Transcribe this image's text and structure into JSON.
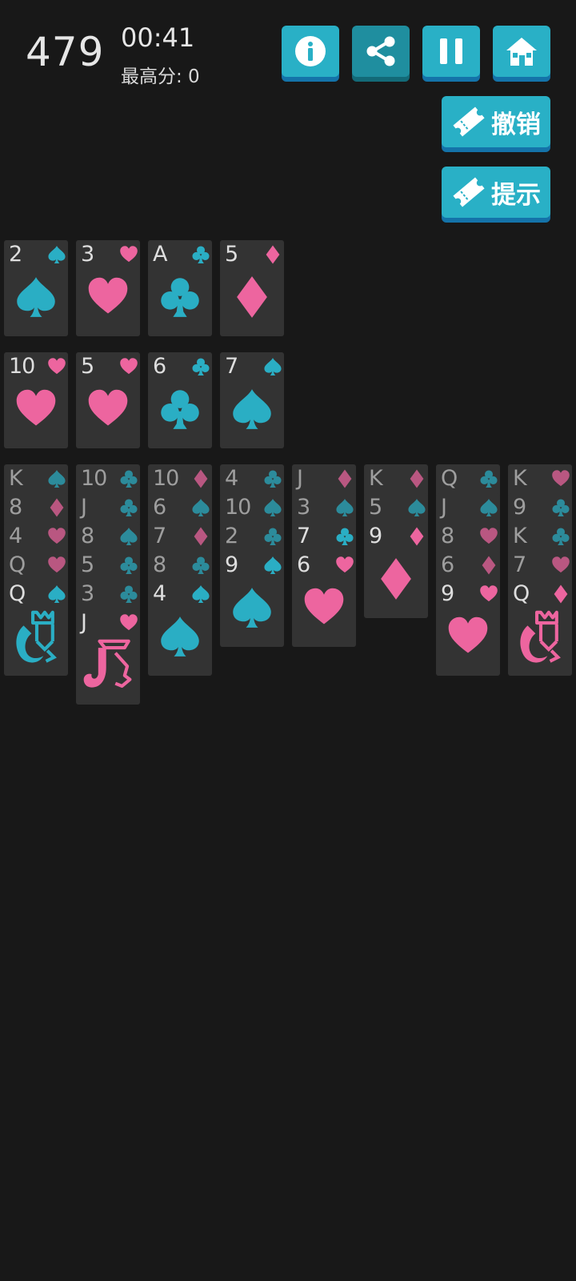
{
  "header": {
    "score": "479",
    "timer": "00:41",
    "best_score": "最高分:  0"
  },
  "toolbar": [
    {
      "name": "info-button",
      "icon": "info-icon"
    },
    {
      "name": "share-button",
      "icon": "share-icon"
    },
    {
      "name": "pause-button",
      "icon": "pause-icon"
    },
    {
      "name": "home-button",
      "icon": "home-icon"
    }
  ],
  "actions": {
    "undo_label": "撤销",
    "hint_label": "提示"
  },
  "colors": {
    "black_suit": "#2aaec4",
    "red_suit": "#ed659f",
    "button": "#29b0c6",
    "background": "#181818",
    "card": "#333333"
  },
  "free_cells": [
    {
      "rank": "2",
      "suit": "spade"
    },
    {
      "rank": "3",
      "suit": "heart"
    },
    {
      "rank": "A",
      "suit": "club"
    },
    {
      "rank": "5",
      "suit": "diamond"
    }
  ],
  "foundations": [
    {
      "rank": "10",
      "suit": "heart"
    },
    {
      "rank": "5",
      "suit": "heart"
    },
    {
      "rank": "6",
      "suit": "club"
    },
    {
      "rank": "7",
      "suit": "spade"
    }
  ],
  "tableau": [
    {
      "cards": [
        {
          "rank": "K",
          "suit": "spade",
          "up": false
        },
        {
          "rank": "8",
          "suit": "diamond",
          "up": false
        },
        {
          "rank": "4",
          "suit": "heart",
          "up": false
        },
        {
          "rank": "Q",
          "suit": "heart",
          "up": false
        },
        {
          "rank": "Q",
          "suit": "spade",
          "up": true
        }
      ]
    },
    {
      "cards": [
        {
          "rank": "10",
          "suit": "club",
          "up": false
        },
        {
          "rank": "J",
          "suit": "club",
          "up": false
        },
        {
          "rank": "8",
          "suit": "spade",
          "up": false
        },
        {
          "rank": "5",
          "suit": "club",
          "up": false
        },
        {
          "rank": "3",
          "suit": "club",
          "up": false
        },
        {
          "rank": "J",
          "suit": "heart",
          "up": true
        }
      ]
    },
    {
      "cards": [
        {
          "rank": "10",
          "suit": "diamond",
          "up": false
        },
        {
          "rank": "6",
          "suit": "spade",
          "up": false
        },
        {
          "rank": "7",
          "suit": "diamond",
          "up": false
        },
        {
          "rank": "8",
          "suit": "club",
          "up": false
        },
        {
          "rank": "4",
          "suit": "spade",
          "up": true
        }
      ]
    },
    {
      "cards": [
        {
          "rank": "4",
          "suit": "club",
          "up": false
        },
        {
          "rank": "10",
          "suit": "spade",
          "up": false
        },
        {
          "rank": "2",
          "suit": "club",
          "up": false
        },
        {
          "rank": "9",
          "suit": "spade",
          "up": true
        }
      ]
    },
    {
      "cards": [
        {
          "rank": "J",
          "suit": "diamond",
          "up": false
        },
        {
          "rank": "3",
          "suit": "spade",
          "up": false
        },
        {
          "rank": "7",
          "suit": "club",
          "up": true
        },
        {
          "rank": "6",
          "suit": "heart",
          "up": true
        }
      ]
    },
    {
      "cards": [
        {
          "rank": "K",
          "suit": "diamond",
          "up": false
        },
        {
          "rank": "5",
          "suit": "spade",
          "up": false
        },
        {
          "rank": "9",
          "suit": "diamond",
          "up": true
        }
      ]
    },
    {
      "cards": [
        {
          "rank": "Q",
          "suit": "club",
          "up": false
        },
        {
          "rank": "J",
          "suit": "spade",
          "up": false
        },
        {
          "rank": "8",
          "suit": "heart",
          "up": false
        },
        {
          "rank": "6",
          "suit": "diamond",
          "up": false
        },
        {
          "rank": "9",
          "suit": "heart",
          "up": true
        }
      ]
    },
    {
      "cards": [
        {
          "rank": "K",
          "suit": "heart",
          "up": false
        },
        {
          "rank": "9",
          "suit": "club",
          "up": false
        },
        {
          "rank": "K",
          "suit": "club",
          "up": false
        },
        {
          "rank": "7",
          "suit": "heart",
          "up": false
        },
        {
          "rank": "Q",
          "suit": "diamond",
          "up": true
        }
      ]
    }
  ]
}
